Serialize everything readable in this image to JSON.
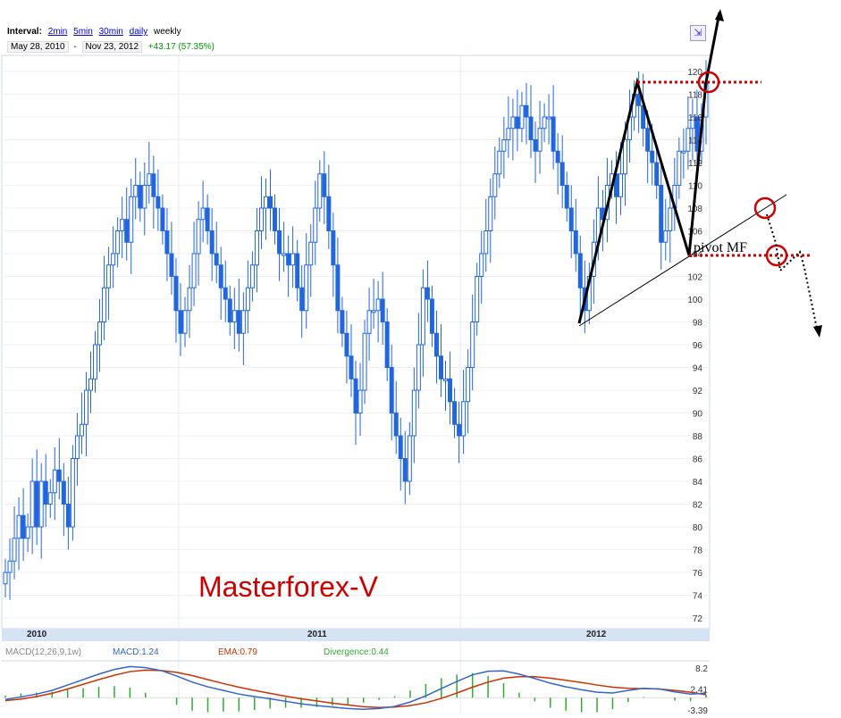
{
  "header": {
    "interval_label": "Interval:",
    "intervals": [
      "2min",
      "5min",
      "30min",
      "daily"
    ],
    "current_interval": "weekly",
    "date_from": "May 28, 2010",
    "date_sep": "-",
    "date_to": "Nov 23, 2012",
    "change": "+43.17 (57.35%)",
    "expand_icon": "expand-arrows-icon"
  },
  "colors": {
    "up_candle": "#2266dd",
    "down_candle": "#2266dd",
    "macd_line": "#3366cc",
    "ema_line": "#cc3300",
    "divergence": "#33aa33",
    "annotation": "#000000",
    "circle": "#cc0000",
    "watermark": "#cc0000"
  },
  "chart_data": {
    "type": "candlestick",
    "title": "",
    "xlabel": "",
    "ylabel": "",
    "ylim": [
      71,
      121
    ],
    "yticks": [
      72,
      74,
      76,
      78,
      80,
      82,
      84,
      86,
      88,
      90,
      92,
      94,
      96,
      98,
      100,
      102,
      104,
      106,
      108,
      110,
      112,
      114,
      116,
      118,
      120
    ],
    "xticks": [
      "2010",
      "2011",
      "2012"
    ],
    "grid": true,
    "close": [
      76,
      77,
      79,
      81,
      79,
      80,
      84,
      80,
      84,
      82,
      83,
      85,
      84,
      82,
      80,
      86,
      88,
      89,
      92,
      93,
      96,
      98,
      101,
      103,
      104,
      106,
      107,
      105,
      109,
      110,
      108,
      110,
      111,
      109,
      108,
      106,
      104,
      102,
      99,
      97,
      99,
      101,
      104,
      107,
      108,
      106,
      104,
      103,
      101,
      100,
      98,
      99,
      97,
      99,
      101,
      103,
      106,
      108,
      109,
      108,
      106,
      104,
      104,
      103,
      104,
      101,
      99,
      103,
      105,
      108,
      111,
      109,
      106,
      103,
      99,
      97,
      95,
      93,
      90,
      92,
      97,
      99,
      99,
      100,
      98,
      94,
      90,
      88,
      86,
      84,
      88,
      92,
      96,
      101,
      100,
      97,
      95,
      93,
      93,
      91,
      89,
      88,
      91,
      94,
      98,
      102,
      104,
      106,
      109,
      111,
      113,
      114,
      115,
      116,
      115,
      117,
      116,
      114,
      113,
      115,
      116,
      116,
      113,
      112,
      110,
      108,
      106,
      104,
      101,
      99,
      102,
      105,
      108,
      107,
      110,
      111,
      109,
      111,
      114,
      116,
      118,
      117,
      115,
      113,
      112,
      110,
      105,
      106,
      108,
      110,
      113,
      113,
      115,
      116,
      113,
      116,
      119
    ],
    "ema": 0.79,
    "macd": {
      "label": "MACD(12,26,9,1w)",
      "macd_label": "MACD:1.24",
      "ema_label": "EMA:0.79",
      "divergence_label": "Divergence:0.44",
      "yticks": [
        8.2,
        2.41,
        -3.39
      ],
      "macd_values": [
        -0.5,
        0.2,
        1.0,
        2.0,
        3.5,
        5.0,
        6.5,
        7.8,
        8.6,
        8.3,
        7.5,
        6.0,
        4.3,
        3.0,
        2.0,
        1.0,
        0.3,
        -0.3,
        -1.0,
        -1.7,
        -2.2,
        -2.6,
        -3.0,
        -3.2,
        -3.0,
        -2.4,
        -1.2,
        0.5,
        2.5,
        4.5,
        6.3,
        7.3,
        7.4,
        6.5,
        5.3,
        4.0,
        3.0,
        2.2,
        1.5,
        1.3,
        2.0,
        2.6,
        2.4,
        1.6,
        1.0,
        1.24
      ],
      "signal_values": [
        -0.8,
        -0.4,
        0.3,
        1.2,
        2.4,
        3.7,
        5.0,
        6.2,
        7.2,
        7.6,
        7.5,
        7.0,
        6.1,
        5.0,
        3.9,
        2.9,
        2.0,
        1.2,
        0.4,
        -0.3,
        -0.9,
        -1.5,
        -2.0,
        -2.5,
        -2.7,
        -2.6,
        -2.2,
        -1.4,
        -0.2,
        1.3,
        2.9,
        4.3,
        5.4,
        5.8,
        5.8,
        5.4,
        4.8,
        4.2,
        3.5,
        2.9,
        2.6,
        2.5,
        2.4,
        2.0,
        1.5,
        0.79
      ]
    },
    "annotations": {
      "pivot_label": "pivot MF",
      "watermark": "Masterforex-V"
    }
  }
}
